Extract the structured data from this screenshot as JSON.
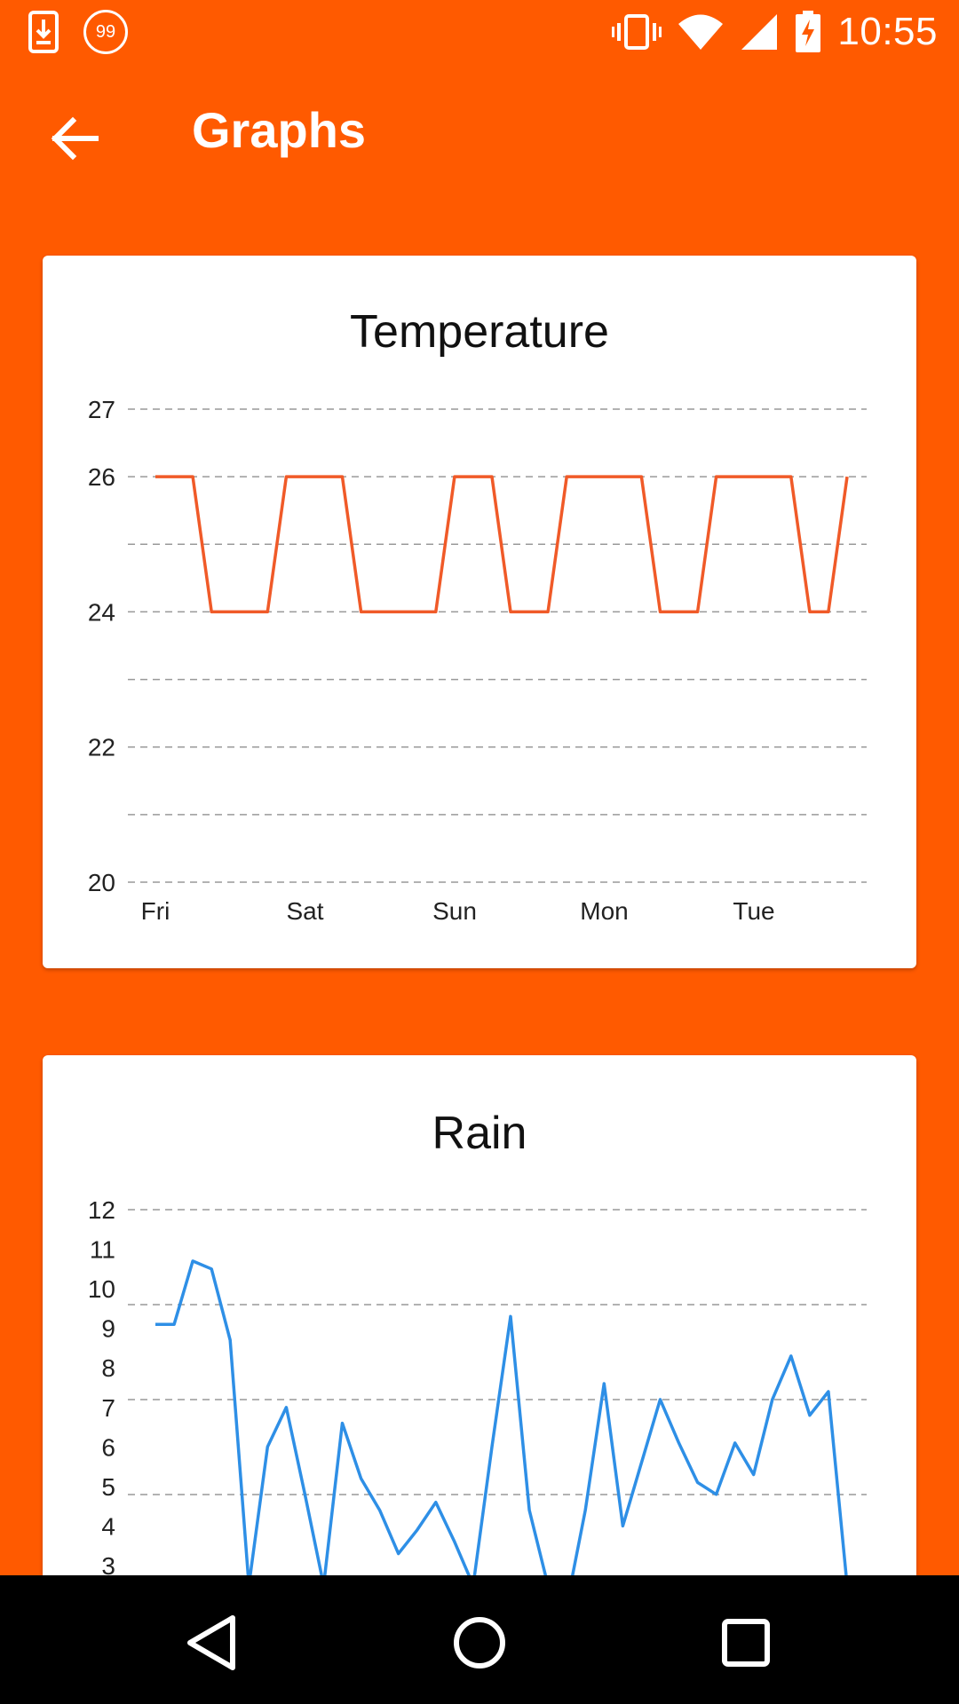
{
  "status_bar": {
    "time": "10:55",
    "notification_badge": "99",
    "icons": [
      "download-icon",
      "notification-badge-icon",
      "vibrate-icon",
      "wifi-icon",
      "signal-icon",
      "battery-charging-icon"
    ]
  },
  "app_bar": {
    "title": "Graphs",
    "back_icon": "arrow-back-icon"
  },
  "colors": {
    "primary": "#FF5A00",
    "temperature_line": "#F05A28",
    "rain_line": "#2E8FE6",
    "grid": "#999999"
  },
  "charts": {
    "temperature": {
      "title": "Temperature"
    },
    "rain": {
      "title": "Rain"
    }
  },
  "chart_data": [
    {
      "type": "line",
      "title": "Temperature",
      "categories": [
        "Fri",
        "Sat",
        "Sun",
        "Mon",
        "Tue"
      ],
      "yticks": [
        20,
        22,
        24,
        26,
        27
      ],
      "ylim": [
        20,
        27
      ],
      "grid": true,
      "series": [
        {
          "values": [
            26,
            26,
            26,
            24,
            24,
            24,
            24,
            26,
            26,
            26,
            26,
            24,
            24,
            24,
            24,
            24,
            26,
            26,
            26,
            24,
            24,
            24,
            26,
            26,
            26,
            26,
            26,
            24,
            24,
            24,
            26,
            26,
            26,
            26,
            26,
            24,
            24,
            26
          ]
        }
      ]
    },
    {
      "type": "line",
      "title": "Rain",
      "yticks": [
        3,
        4,
        5,
        6,
        7,
        8,
        9,
        10,
        11,
        12
      ],
      "ylim": [
        3,
        12
      ],
      "grid": true,
      "series": [
        {
          "values": [
            9.1,
            9.1,
            10.7,
            10.5,
            8.7,
            2.5,
            6.0,
            7.0,
            4.8,
            2.5,
            6.6,
            5.2,
            4.4,
            3.3,
            3.9,
            4.6,
            3.6,
            2.5,
            6.0,
            9.3,
            4.4,
            2.5,
            2.0,
            4.4,
            7.6,
            4.0,
            5.6,
            7.2,
            6.1,
            5.1,
            4.8,
            6.1,
            5.3,
            7.2,
            8.3,
            6.8,
            7.4,
            2.5
          ]
        }
      ]
    }
  ]
}
